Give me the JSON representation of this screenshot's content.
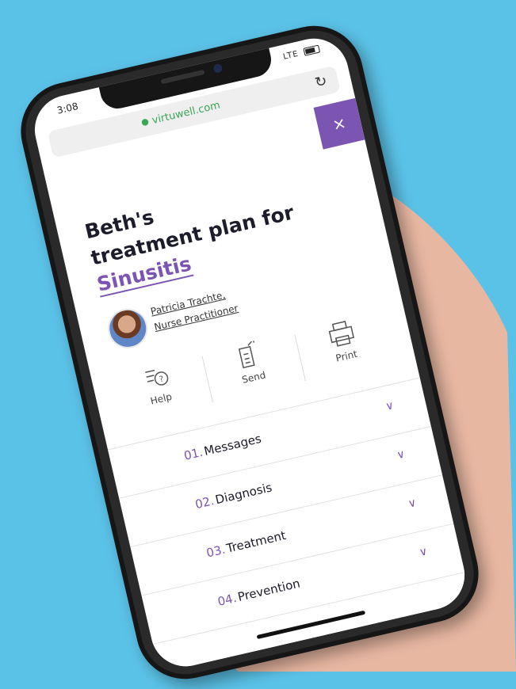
{
  "status_bar": {
    "time": "3:08",
    "signal": "LTE"
  },
  "browser": {
    "url": "virtuwell.com"
  },
  "close_label": "×",
  "plan": {
    "line1": "Beth's",
    "line2": "treatment plan for",
    "condition": "Sinusitis"
  },
  "provider": {
    "name": "Patricia Trachte,",
    "role": "Nurse Practitioner"
  },
  "actions": [
    {
      "label": "Help"
    },
    {
      "label": "Send"
    },
    {
      "label": "Print"
    }
  ],
  "sections": [
    {
      "number": "01.",
      "label": "Messages"
    },
    {
      "number": "02.",
      "label": "Diagnosis"
    },
    {
      "number": "03.",
      "label": "Treatment"
    },
    {
      "number": "04.",
      "label": "Prevention"
    }
  ],
  "colors": {
    "background": "#5bc2e7",
    "accent": "#7c55b3",
    "url_green": "#3aa657"
  }
}
